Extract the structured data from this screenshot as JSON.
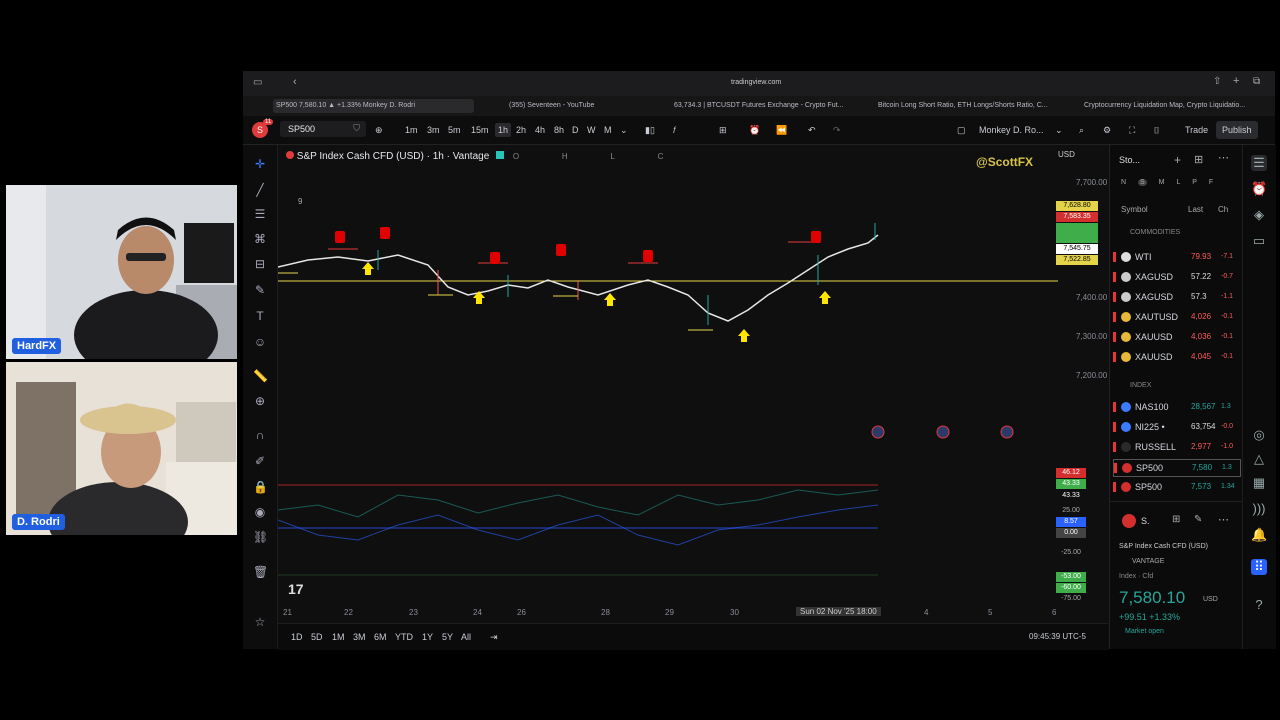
{
  "webcams": [
    {
      "name": "HardFX"
    },
    {
      "name": "D. Rodri"
    }
  ],
  "browser": {
    "url": "tradingview.com",
    "tabs": [
      "SP500 7,580.10 ▲ +1.33% Monkey D. Rodri",
      "(355) Seventeen - YouTube",
      "63,734.3 | BTCUSDT Futures Exchange - Crypto Fut...",
      "Bitcoin Long Short Ratio, ETH Longs/Shorts Ratio, C...",
      "Cryptocurrency Liquidation Map, Crypto Liquidatio..."
    ]
  },
  "toolbar": {
    "avatar_letter": "S",
    "notif_count": "11",
    "symbol": "SP500",
    "intervals": [
      "1m",
      "3m",
      "5m",
      "15m",
      "1h",
      "2h",
      "4h",
      "8h",
      "D",
      "W",
      "M"
    ],
    "active_interval": "1h",
    "layout_name": "Monkey D. Ro...",
    "trade_label": "Trade",
    "publish_label": "Publish"
  },
  "chart": {
    "title": "S&P Index Cash CFD (USD) · 1h · Vantage",
    "ohlc_o": "O",
    "ohlc_h": "H",
    "ohlc_l": "L",
    "ohlc_c": "C",
    "currency": "USD",
    "watermark": "@ScottFX",
    "indicator_count": "9",
    "price_ticks": [
      "7,700.00",
      "7,400.00",
      "7,300.00",
      "7,200.00"
    ],
    "price_labels": [
      "7,628.80",
      "7,583.35",
      "7,545.75",
      "7,522.85"
    ],
    "osc_labels": [
      "46.12",
      "43.33",
      "43.33",
      "25.00",
      "8.57",
      "0.00",
      "-25.00",
      "-53.00",
      "-60.00",
      "-75.00"
    ],
    "date_ticks": [
      "21",
      "22",
      "23",
      "24",
      "26",
      "28",
      "29",
      "30",
      "4",
      "5",
      "6"
    ],
    "cursor_date": "Sun 02 Nov '25  18:00",
    "ranges": [
      "1D",
      "5D",
      "1M",
      "3M",
      "6M",
      "YTD",
      "1Y",
      "5Y",
      "All"
    ],
    "clock": "09:45:39 UTC-5",
    "logo": "17"
  },
  "watchlist": {
    "title": "Sto...",
    "filters": [
      "N",
      "S",
      "M",
      "L",
      "P",
      "F"
    ],
    "col_symbol": "Symbol",
    "col_last": "Last",
    "col_chg": "Ch",
    "sections": [
      {
        "name": "COMMODITIES",
        "rows": [
          {
            "sym": "WTI",
            "last": "79.93",
            "chg": "-7.1"
          },
          {
            "sym": "XAGUSD",
            "last": "57.22",
            "chg": "-0.7"
          },
          {
            "sym": "XAGUSD",
            "last": "57.3",
            "chg": "-1.1"
          },
          {
            "sym": "XAUTUSD",
            "last": "4,026",
            "chg": "-0.1"
          },
          {
            "sym": "XAUUSD",
            "last": "4,036",
            "chg": "-0.1"
          },
          {
            "sym": "XAUUSD",
            "last": "4,045",
            "chg": "-0.1"
          }
        ]
      },
      {
        "name": "INDEX",
        "rows": [
          {
            "sym": "NAS100",
            "last": "28,567",
            "chg": "1.3"
          },
          {
            "sym": "NI225 •",
            "last": "63,754",
            "chg": "-0.0"
          },
          {
            "sym": "RUSSELL",
            "last": "2,977",
            "chg": "-1.0"
          },
          {
            "sym": "SP500",
            "last": "7,580",
            "chg": "1.3"
          },
          {
            "sym": "SP500",
            "last": "7,573",
            "chg": "1.34"
          }
        ]
      }
    ],
    "detail": {
      "short": "S.",
      "name": "S&P Index Cash CFD (USD)",
      "broker": "VANTAGE",
      "type": "Index · Cfd",
      "price": "7,580.10",
      "currency": "USD",
      "change": "+99.51 +1.33%",
      "status": "Market open"
    }
  },
  "colors": {
    "up": "#26a69a",
    "down": "#ef5350",
    "accent": "#2962ff",
    "signal_buy": "#ffe600",
    "signal_sell": "#e00000"
  }
}
